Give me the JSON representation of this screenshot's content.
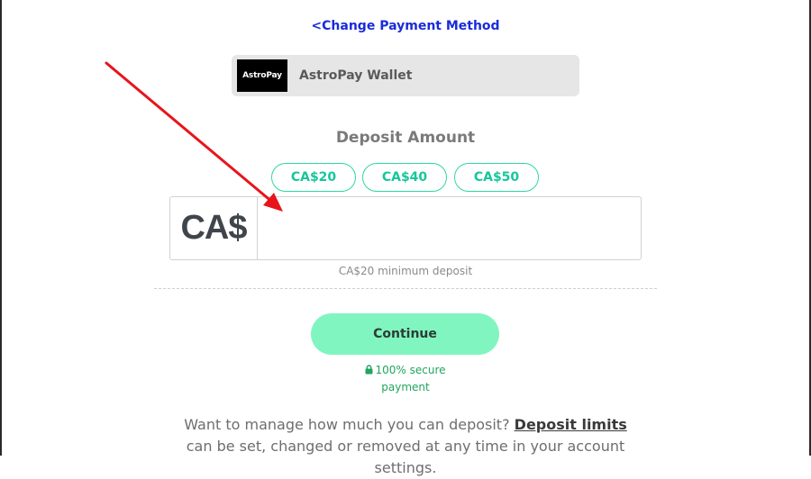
{
  "change_method": {
    "chevron": "<",
    "label": "Change Payment Method"
  },
  "payment_method": {
    "logo_text": "AstroPay",
    "name": "AstroPay Wallet"
  },
  "deposit": {
    "title": "Deposit Amount",
    "presets": [
      "CA$20",
      "CA$40",
      "CA$50"
    ],
    "currency_symbol": "CA$",
    "amount_value": "",
    "minimum_note": "CA$20 minimum deposit"
  },
  "continue": {
    "label": "Continue"
  },
  "secure": {
    "line1": "100% secure",
    "line2": "payment",
    "icon": "lock-icon"
  },
  "limits": {
    "prefix": "Want to manage how much you can deposit? ",
    "link": "Deposit limits",
    "suffix": " can be set, changed or removed at any time in your account settings."
  },
  "colors": {
    "link_blue": "#1a2bd9",
    "accent_green": "#2fd6a2",
    "button_green": "#80f5c0",
    "secure_green": "#1fa55e",
    "annotation_red": "#e8141c"
  }
}
